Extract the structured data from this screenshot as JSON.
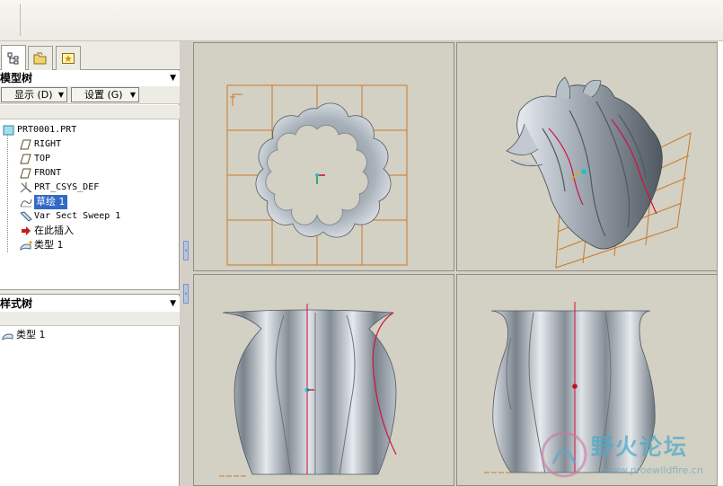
{
  "model_tree": {
    "header": "模型树",
    "display_button": "显示 (D)",
    "settings_button": "设置 (G)",
    "items": [
      {
        "label": "PRT0001.PRT",
        "icon": "part-icon"
      },
      {
        "label": "RIGHT",
        "icon": "datum-plane-icon"
      },
      {
        "label": "TOP",
        "icon": "datum-plane-icon"
      },
      {
        "label": "FRONT",
        "icon": "datum-plane-icon"
      },
      {
        "label": "PRT_CSYS_DEF",
        "icon": "csys-icon"
      },
      {
        "label": "草绘 1",
        "icon": "sketch-icon"
      },
      {
        "label": "Var Sect Sweep 1",
        "icon": "sweep-icon"
      },
      {
        "label": "在此插入",
        "icon": "insert-arrow-icon"
      },
      {
        "label": "类型 1",
        "icon": "style-icon"
      }
    ]
  },
  "style_tree": {
    "header": "样式树",
    "items": [
      {
        "label": "类型 1",
        "icon": "style-icon"
      }
    ]
  },
  "watermark": {
    "name": "野火论坛",
    "url": "www.proewildfire.cn"
  },
  "colors": {
    "viewport_bg": "#d3d0c4",
    "grid": "#c87a28",
    "model_surface": "#a3adb7",
    "sweep_trajectory": "#d01040",
    "selection": "#316ac5"
  }
}
